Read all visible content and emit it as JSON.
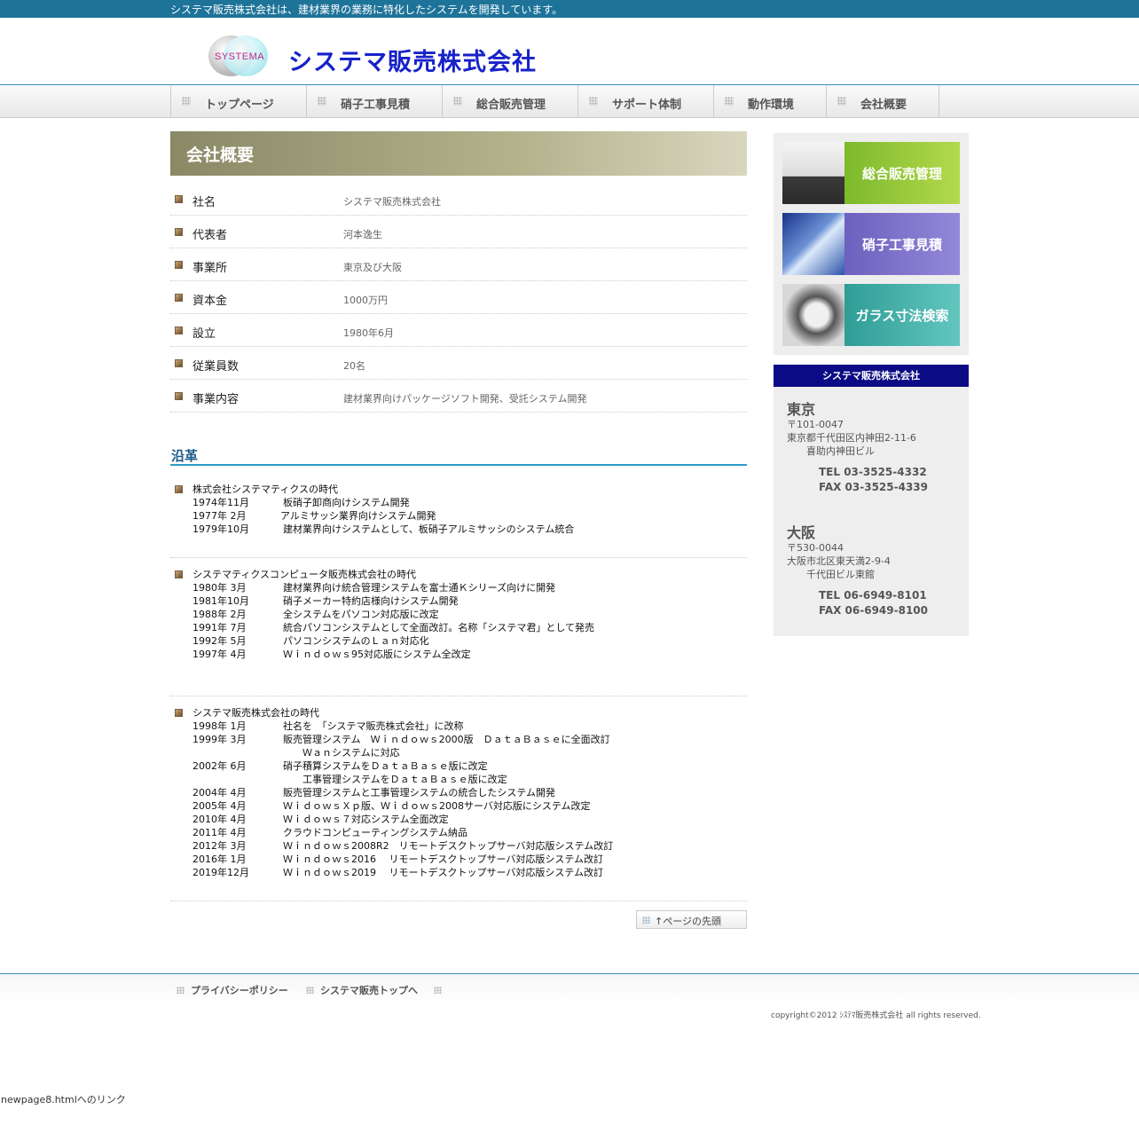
{
  "header": {
    "tagline": "システマ販売株式会社は、建材業界の業務に特化したシステムを開発しています。",
    "logo_text": "SYSTEMA",
    "company_name": "システマ販売株式会社"
  },
  "nav": {
    "items": [
      "トップページ",
      "硝子工事見積",
      "総合販売管理",
      "サポート体制",
      "動作環境",
      "会社概要"
    ]
  },
  "main": {
    "heading": "会社概要",
    "profile": [
      {
        "key": "社名",
        "value": "システマ販売株式会社"
      },
      {
        "key": "代表者",
        "value": "河本逸生"
      },
      {
        "key": "事業所",
        "value": "東京及び大阪"
      },
      {
        "key": "資本金",
        "value": "1000万円"
      },
      {
        "key": "設立",
        "value": "1980年6月"
      },
      {
        "key": "従業員数",
        "value": "20名"
      },
      {
        "key": "事業内容",
        "value": "建材業界向けパッケージソフト開発、受託システム開発"
      }
    ],
    "history_heading": "沿革",
    "history": [
      {
        "title": "株式会社システマティクスの時代",
        "lines": [
          [
            "1974年11月",
            "板硝子卸商向けシステム開発"
          ],
          [
            "1977年 2月",
            "アルミサッシ業界向けシステム開発"
          ],
          [
            "1979年10月",
            "建材業界向けシステムとして、板硝子アルミサッシのシステム統合"
          ]
        ]
      },
      {
        "title": "システマティクスコンピュータ販売株式会社の時代",
        "lines": [
          [
            "1980年 3月",
            "建材業界向け統合管理システムを富士通Ｋシリーズ向けに開発"
          ],
          [
            "1981年10月",
            " 硝子メーカー特約店様向けシステム開発"
          ],
          [
            "1988年 2月",
            "全システムをパソコン対応版に改定"
          ],
          [
            "1991年 7月",
            "統合パソコンシステムとして全面改訂。名称「システマ君」として発売"
          ],
          [
            "1992年 5月",
            "パソコンシステムのＬａｎ対応化"
          ],
          [
            "1997年 4月",
            "Ｗｉｎｄｏｗｓ95対応版にシステム全改定"
          ]
        ]
      },
      {
        "title": "システマ販売株式会社の時代",
        "lines": [
          [
            "1998年 1月",
            "社名を　「システマ販売株式会社」に改称"
          ],
          [
            "1999年 3月",
            "販売管理システム　Ｗｉｎｄｏｗｓ2000版　ＤａｔａＢａｓｅに全面改訂"
          ],
          [
            "",
            "　　Ｗａｎシステムに対応"
          ],
          [
            "2002年 6月",
            "硝子積算システムをＤａｔａＢａｓｅ版に改定"
          ],
          [
            "",
            "　　工事管理システムをＤａｔａＢａｓｅ版に改定"
          ],
          [
            "2004年 4月",
            "販売管理システムと工事管理システムの統合したシステム開発"
          ],
          [
            "2005年 4月",
            "ＷｉｄｏｗｓＸｐ版、Ｗｉｄｏｗｓ2008サーバ対応版にシステム改定"
          ],
          [
            "2010年 4月",
            "Ｗｉｄｏｗｓ７対応システム全面改定"
          ],
          [
            "2011年 4月",
            "クラウドコンピューティングシステム納品"
          ],
          [
            "2012年 3月",
            "Ｗｉｎｄｏｗｓ2008R2　リモートデスクトップサーバ対応版システム改訂"
          ],
          [
            "2016年 1月",
            "Ｗｉｎｄｏｗｓ2016　 リモートデスクトップサーバ対応版システム改訂"
          ],
          [
            "2019年12月",
            " Ｗｉｎｄｏｗｓ2019　 リモートデスクトップサーバ対応版システム改訂"
          ]
        ]
      }
    ],
    "page_top": "↑ページの先頭"
  },
  "sidebar": {
    "banners": [
      {
        "label": "総合販売管理",
        "color": "#8ec43a"
      },
      {
        "label": "硝子工事見積",
        "color": "#7b6fc7"
      },
      {
        "label": "ガラス寸法検索",
        "color": "#3aaea6"
      }
    ],
    "info_title": "システマ販売株式会社",
    "tokyo": {
      "city": "東京",
      "zip": "〒101-0047",
      "addr1": "東京都千代田区内神田2-11-6",
      "addr2": "　　喜助内神田ビル",
      "tel": "TEL 03-3525-4332",
      "fax": "FAX 03-3525-4339"
    },
    "osaka": {
      "city": "大阪",
      "zip": "〒530-0044",
      "addr1": "大阪市北区東天満2-9-4",
      "addr2": "　　千代田ビル東館",
      "tel": "TEL 06-6949-8101",
      "fax": "FAX 06-6949-8100"
    }
  },
  "footer": {
    "links": [
      "プライバシーポリシー",
      "システマ販売トップへ"
    ],
    "copyright": "copyright©2012 ｼｽﾃﾏ販売株式会社 all rights reserved."
  },
  "status_bar": "newpage8.htmlへのリンク"
}
